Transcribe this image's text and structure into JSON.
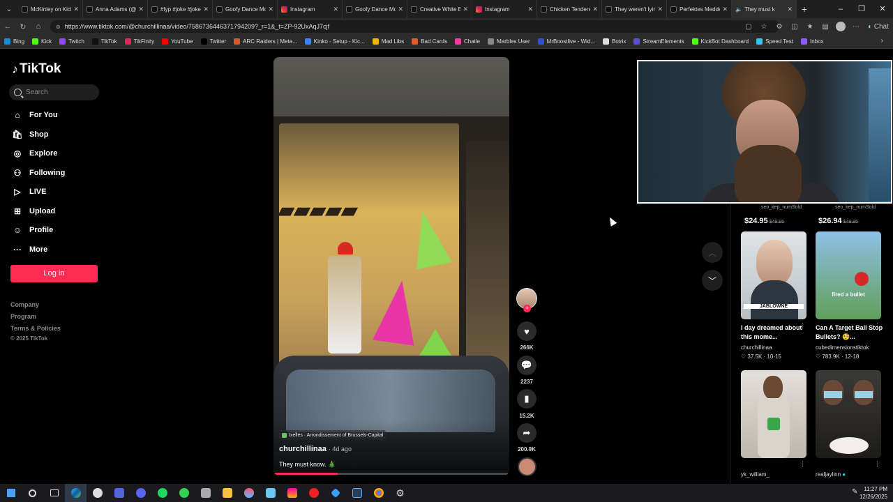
{
  "browser": {
    "tabs": [
      {
        "label": "McKinley on Kick",
        "icon": "tiktok"
      },
      {
        "label": "Anna Adams (@a",
        "icon": "tiktok"
      },
      {
        "label": "#fyp #joke #jokes",
        "icon": "tiktok"
      },
      {
        "label": "Goofy Dance Mo",
        "icon": "tiktok"
      },
      {
        "label": "Instagram",
        "icon": "instagram"
      },
      {
        "label": "Goofy Dance Mo",
        "icon": "tiktok"
      },
      {
        "label": "Creative White E",
        "icon": "tiktok"
      },
      {
        "label": "Instagram",
        "icon": "instagram"
      },
      {
        "label": "Chicken Tenders",
        "icon": "tiktok"
      },
      {
        "label": "They weren't lyin",
        "icon": "tiktok"
      },
      {
        "label": "Perfektes Medde",
        "icon": "tiktok"
      },
      {
        "label": "They must k",
        "icon": "tiktok",
        "active": true
      }
    ],
    "url": "https://www.tiktok.com/@churchillinaa/video/7586736446371794209?_r=1&_t=ZP-92UxAqJ7cjf",
    "chat_label": "Chat",
    "bookmarks": [
      {
        "label": "Bing",
        "color": "#1b8ad6"
      },
      {
        "label": "Kick",
        "color": "#53fc18"
      },
      {
        "label": "Twitch",
        "color": "#9146ff"
      },
      {
        "label": "TikTok",
        "color": "#111111"
      },
      {
        "label": "TikFinity",
        "color": "#e2245b"
      },
      {
        "label": "YouTube",
        "color": "#ff0000"
      },
      {
        "label": "Twitter",
        "color": "#000000"
      },
      {
        "label": "ARC Raiders | Meta...",
        "color": "#d35a2a"
      },
      {
        "label": "Kinko - Setup - Kic...",
        "color": "#3b82f6"
      },
      {
        "label": "Mad Libs",
        "color": "#f5b301"
      },
      {
        "label": "Bad Cards",
        "color": "#e05a2a"
      },
      {
        "label": "Chatle",
        "color": "#e93fa0"
      },
      {
        "label": "Marbles User",
        "color": "#888888"
      },
      {
        "label": "MrBoostlive - Wid...",
        "color": "#3050d0"
      },
      {
        "label": "Botrix",
        "color": "#dddddd"
      },
      {
        "label": "StreamElements",
        "color": "#5a4fcf"
      },
      {
        "label": "KickBot Dashboard",
        "color": "#53fc18"
      },
      {
        "label": "Speed Test",
        "color": "#39c0f0"
      },
      {
        "label": "Inbox",
        "color": "#8b5cf6"
      }
    ]
  },
  "tiktok": {
    "logo": "TikTok",
    "search_placeholder": "Search",
    "nav": [
      {
        "label": "For You",
        "icon": "home-icon"
      },
      {
        "label": "Shop",
        "icon": "shop-icon"
      },
      {
        "label": "Explore",
        "icon": "compass-icon"
      },
      {
        "label": "Following",
        "icon": "following-icon"
      },
      {
        "label": "LIVE",
        "icon": "live-icon"
      },
      {
        "label": "Upload",
        "icon": "upload-icon"
      },
      {
        "label": "Profile",
        "icon": "profile-icon"
      },
      {
        "label": "More",
        "icon": "more-icon"
      }
    ],
    "login_label": "Log in",
    "footer_links": [
      "Company",
      "Program",
      "Terms & Policies"
    ],
    "copyright": "© 2025 TikTok",
    "video": {
      "location": "Ixelles · Arrondissement of Brussels-Capital",
      "author": "churchillinaa",
      "age": "· 4d ago",
      "caption": "They must know. 🎄",
      "progress": 0.27,
      "likes": "266K",
      "comments": "2237",
      "saves": "15.2K",
      "shares": "200.9K"
    },
    "related": [
      {
        "seller": "seo_kep_numSold",
        "price": "$24.95",
        "old_price": "$49.95"
      },
      {
        "seller": "seo_kep_numSold",
        "price": "$26.94",
        "old_price": "$49.95"
      }
    ],
    "videos": [
      {
        "caption": "I day dreamed about this mome...",
        "author": "churchillinaa",
        "likes": "37.5K",
        "date": "10-15",
        "thumb_text": "JABLOWNE"
      },
      {
        "caption": "Can A Target Ball Stop Bullets? 🧐...",
        "author": "cubedimensionstiktok",
        "likes": "783.9K",
        "date": "12-18",
        "thumb_text": "fired a bullet"
      },
      {
        "caption": "",
        "author": "yk_william_",
        "likes": "",
        "date": "",
        "thumb_text": ""
      },
      {
        "caption": "",
        "author": "realjaylinn",
        "likes": "",
        "date": "",
        "thumb_text": ""
      }
    ]
  },
  "taskbar": {
    "time": "11:27 PM",
    "date": "12/26/2025"
  }
}
